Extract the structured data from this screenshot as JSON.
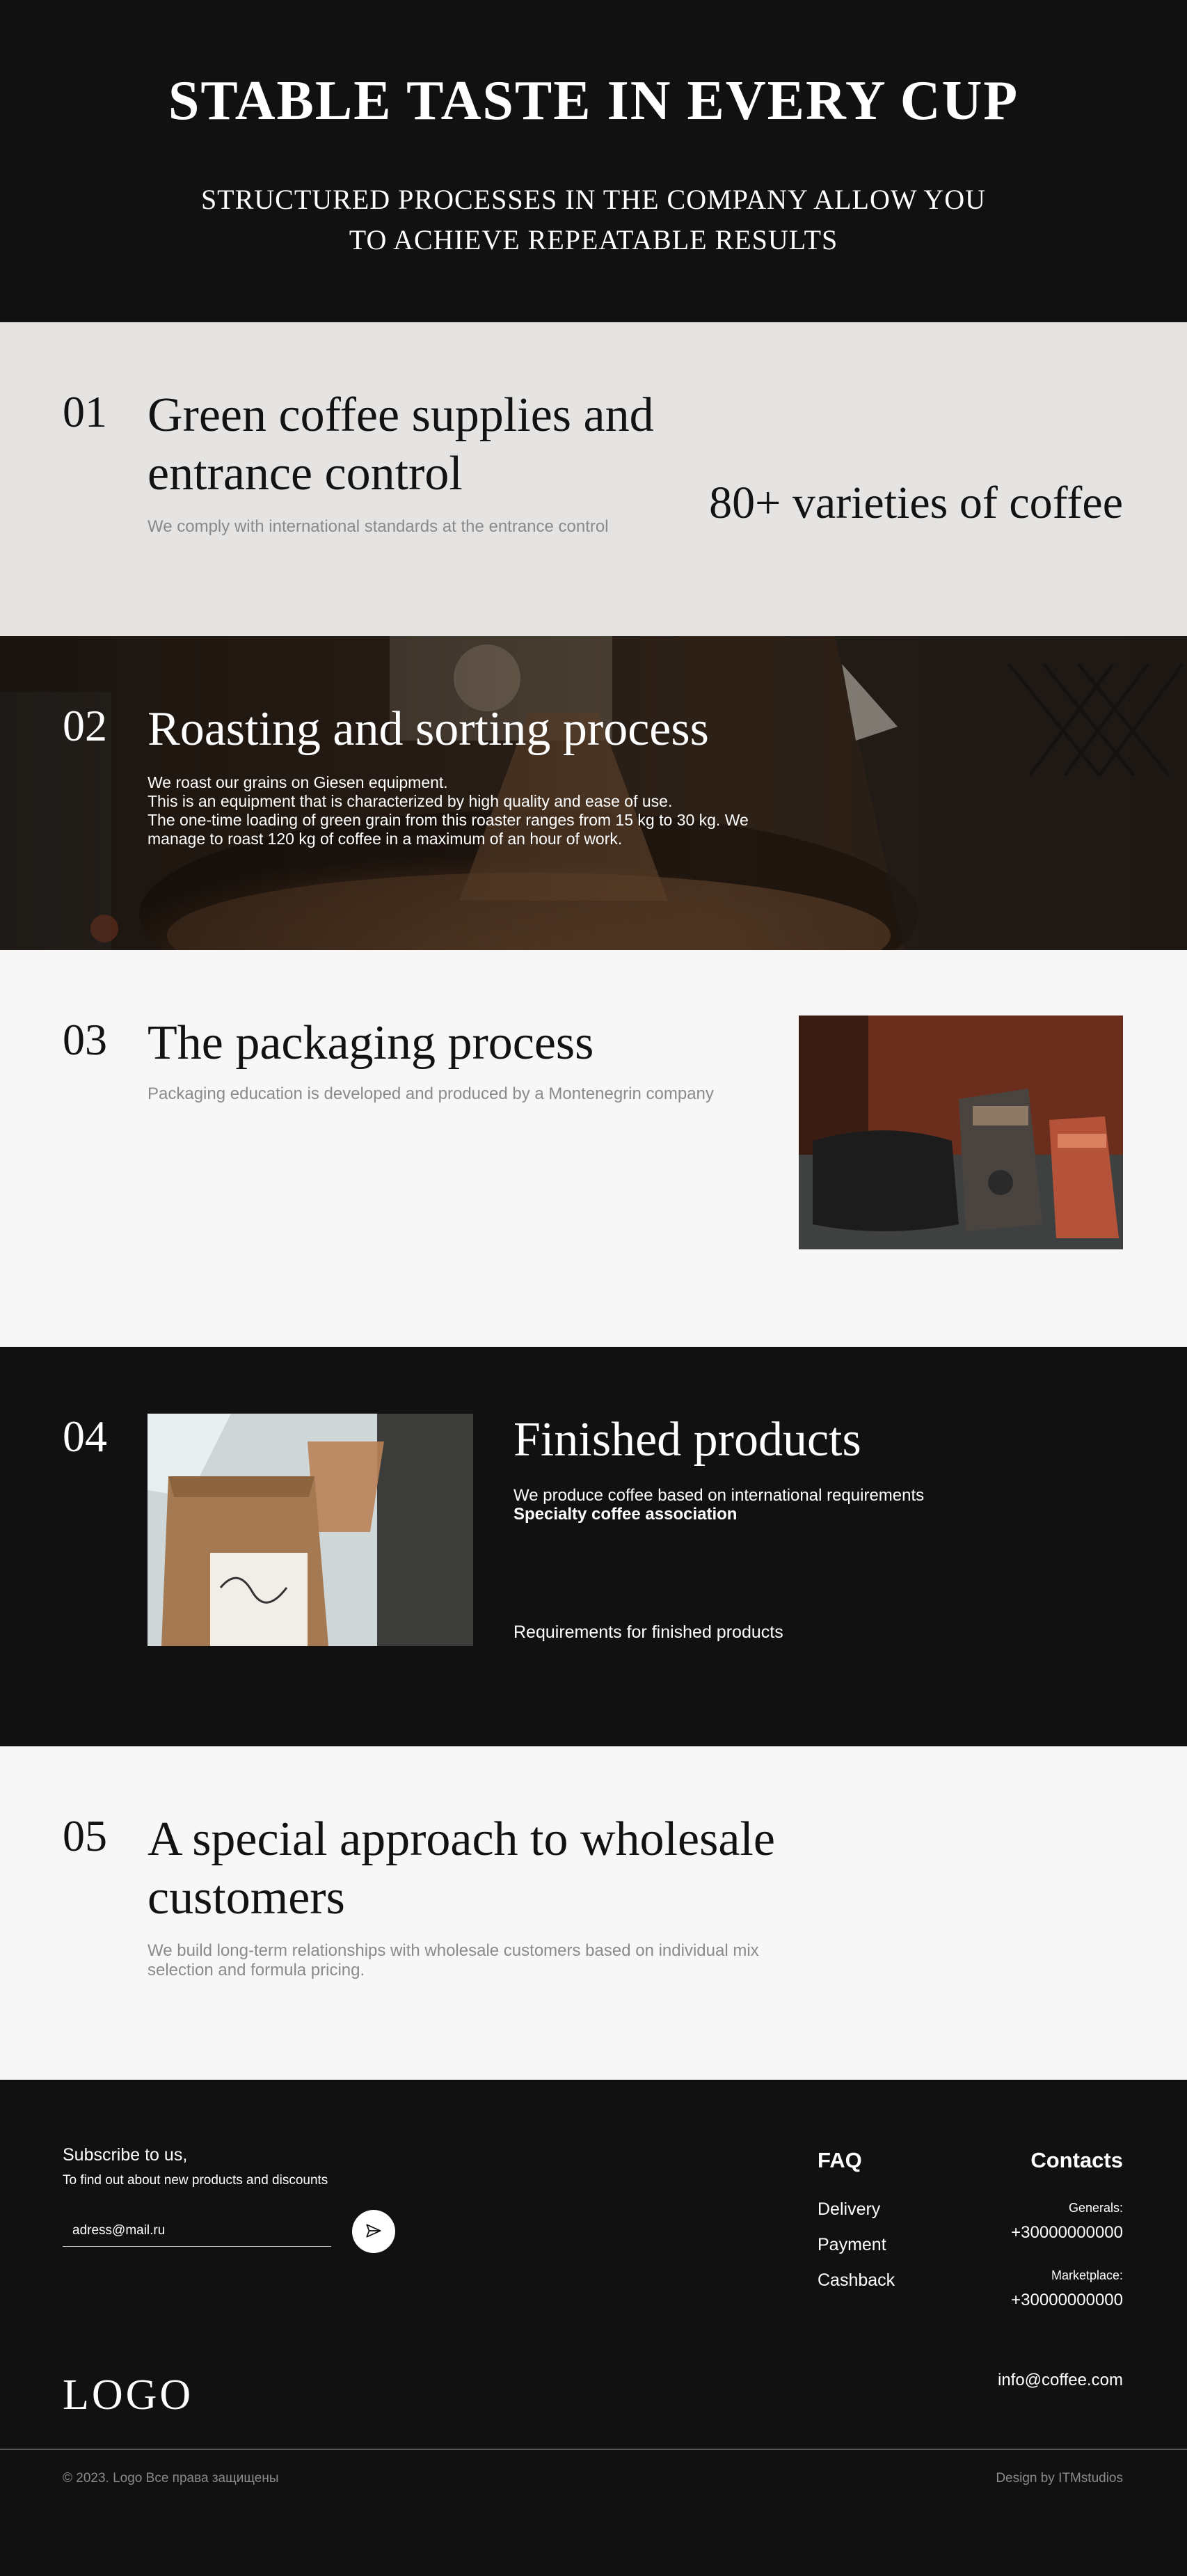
{
  "hero": {
    "title": "STABLE TASTE IN EVERY CUP",
    "subtitle_line1": "STRUCTURED PROCESSES IN THE COMPANY ALLOW YOU",
    "subtitle_line2": "TO ACHIEVE REPEATABLE RESULTS"
  },
  "steps": [
    {
      "number": "01",
      "title_line1": "Green coffee supplies and",
      "title_line2": "entrance control",
      "description": "We comply with international standards at the entrance control",
      "highlight": "80+ varieties of coffee"
    },
    {
      "number": "02",
      "title": "Roasting and sorting process",
      "description_lines": [
        "We roast our grains on Giesen equipment.",
        "This is an equipment that is characterized by high quality and ease of use.",
        "The one-time loading of green grain from this roaster ranges from 15 kg to 30 kg. We",
        "manage to roast 120 kg of coffee in a maximum of an hour of work."
      ]
    },
    {
      "number": "03",
      "title": "The packaging process",
      "description": "Packaging education is developed and produced by a Montenegrin company"
    },
    {
      "number": "04",
      "title": "Finished products",
      "requirement_text": "We produce coffee based on international requirements",
      "requirement_bold": "Specialty coffee association",
      "link": "Requirements for finished products"
    },
    {
      "number": "05",
      "title_line1": "A special approach to wholesale",
      "title_line2": "customers",
      "description_line1": "We build long-term relationships with wholesale customers based on individual mix",
      "description_line2": "selection and formula pricing."
    }
  ],
  "footer": {
    "subscribe_title": "Subscribe to us,",
    "subscribe_subtitle": "To find out about new products and discounts",
    "email_placeholder": "adress@mail.ru",
    "faq_title": "FAQ",
    "faq_items": [
      "Delivery",
      "Payment",
      "Cashback"
    ],
    "contacts_title": "Contacts",
    "generals_label": "Generals:",
    "generals_phone": "+30000000000",
    "marketplace_label": "Marketplace:",
    "marketplace_phone": "+30000000000",
    "email": "info@coffee.com",
    "logo": "LOGO",
    "copyright": "© 2023. Logo Все права защищены",
    "design_credit": "Design by ITMstudios"
  },
  "colors": {
    "dark": "#111111",
    "light_gray": "#e5e4e2",
    "off_white": "#f7f7f7",
    "muted_text": "#8a8a8a"
  }
}
